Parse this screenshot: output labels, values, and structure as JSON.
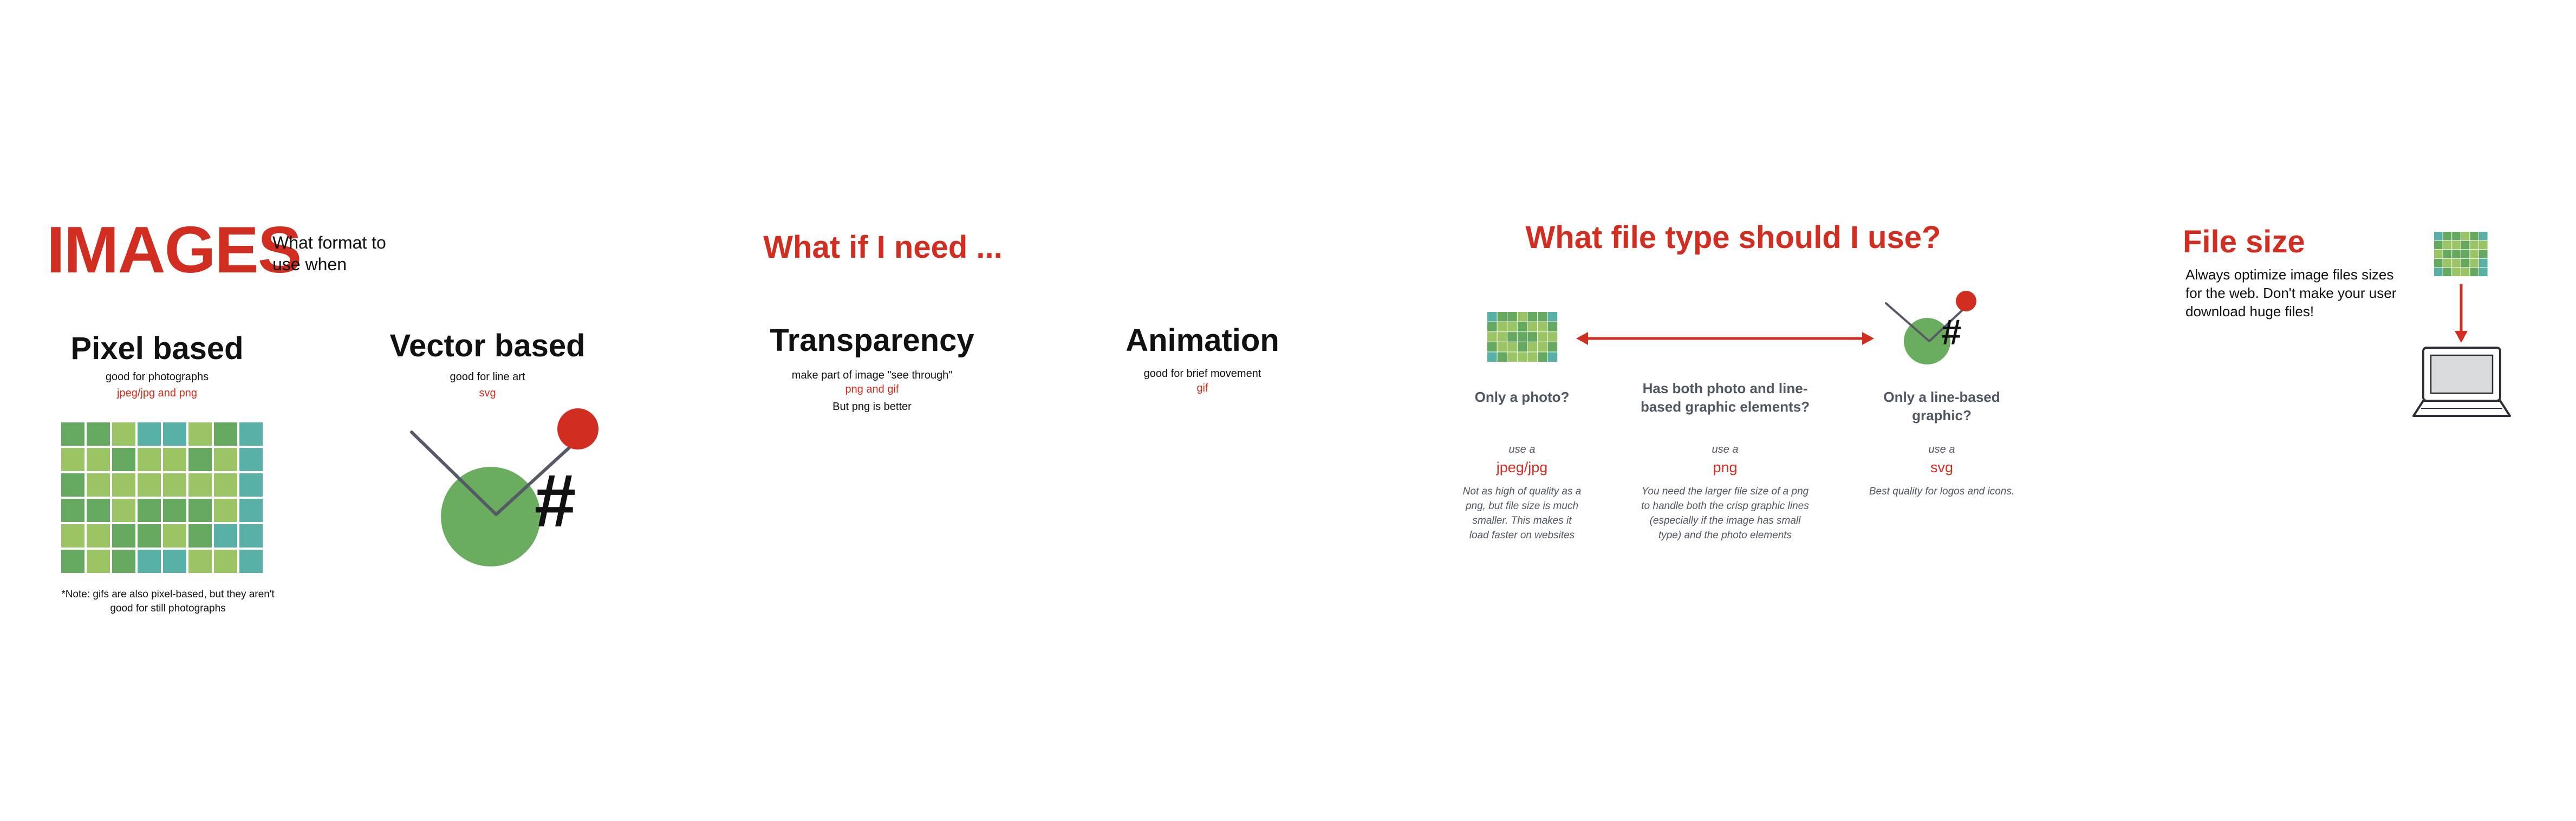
{
  "header": {
    "title": "IMAGES",
    "subtitle": "What format to use when"
  },
  "pixel": {
    "title": "Pixel based",
    "desc": "good for photographs",
    "formats": "jpeg/jpg and png",
    "note": "*Note: gifs are also pixel-based, but they aren't good for still photographs"
  },
  "vector": {
    "title": "Vector based",
    "desc": "good for line art",
    "formats": "svg",
    "glyph": "#"
  },
  "needs": {
    "heading": "What if I need ...",
    "transparency": {
      "title": "Transparency",
      "desc": "make part of image \"see through\"",
      "formats": "png and gif",
      "extra": "But png is better"
    },
    "animation": {
      "title": "Animation",
      "desc": "good for brief movement",
      "formats": "gif"
    }
  },
  "filetype": {
    "heading": "What file type should I use?",
    "glyph": "#",
    "columns": [
      {
        "question": "Only a photo?",
        "use": "use a",
        "format": "jpeg/jpg",
        "desc": "Not as high of quality as a png, but file size is much smaller. This makes it load faster on websites"
      },
      {
        "question": "Has both photo and line-based graphic elements?",
        "use": "use a",
        "format": "png",
        "desc": "You need the larger file size of a png to handle both the crisp graphic lines (especially if the image has small type) and the photo elements"
      },
      {
        "question": "Only a line-based graphic?",
        "use": "use a",
        "format": "svg",
        "desc": "Best quality for logos and icons."
      }
    ]
  },
  "filesize": {
    "heading": "File size",
    "text": "Always optimize image files sizes for the web. Don't make your user download huge files!"
  },
  "icons": {
    "pixel": "pixel-grid-icon",
    "vector": "vector-art-icon",
    "arrow": "double-arrow-icon",
    "down": "down-arrow-icon",
    "laptop": "laptop-icon"
  },
  "colors": {
    "accent": "#d12e21",
    "pixel_dark": "#64a95f",
    "pixel_light": "#9bc464",
    "pixel_teal": "#58b0a6",
    "vector_green": "#6aad5e",
    "text_slate": "#4f5662"
  }
}
